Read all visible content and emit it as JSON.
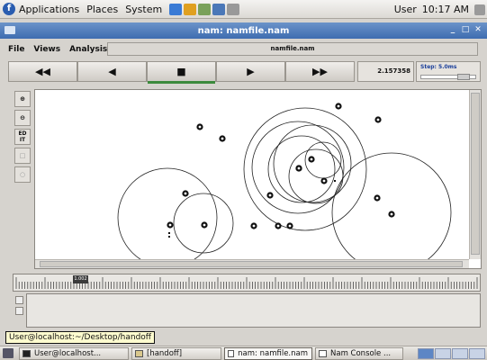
{
  "top_panel": {
    "menus": [
      "Applications",
      "Places",
      "System"
    ],
    "user": "User",
    "clock": "10:17 AM"
  },
  "window": {
    "title": "nam: namfile.nam",
    "controls": [
      "_",
      "□",
      "✕"
    ]
  },
  "menubar": {
    "items": [
      "File",
      "Views",
      "Analysis"
    ],
    "filename": "namfile.nam"
  },
  "playback": {
    "buttons": [
      "◀◀",
      "◀",
      "■",
      "▶",
      "▶▶"
    ],
    "time": "2.157358",
    "step": "Step: 5.0ms"
  },
  "side_tools": [
    "zoom-in-icon",
    "zoom-out-icon",
    "edit-icon",
    "square-icon",
    "circle-icon"
  ],
  "side_tools_labels": {
    "edit": "ED IT"
  },
  "timeline": {
    "marker": "1.002"
  },
  "tooltip": "User@localhost:~/Desktop/handoff",
  "taskbar": {
    "tasks": [
      "User@localhost...",
      "[handoff]",
      "nam: namfile.nam",
      "Nam Console ..."
    ]
  },
  "colors": {
    "titlebar": "#3e6cb0",
    "canvas": "#ffffff",
    "node": "#111111",
    "active_play": "#3c8a3c"
  }
}
